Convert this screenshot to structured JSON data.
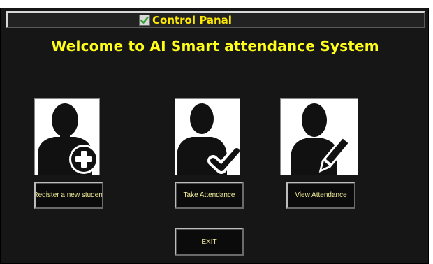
{
  "window": {
    "title": "Control Panal",
    "title_icon": "checkbox-icon"
  },
  "heading": "Welcome to AI Smart attendance System",
  "actions": [
    {
      "label": "Register a new student",
      "icon": "user-add-icon"
    },
    {
      "label": "Take Attendance",
      "icon": "user-check-icon"
    },
    {
      "label": "View Attendance",
      "icon": "user-edit-icon"
    }
  ],
  "exit_label": "EXIT",
  "colors": {
    "background": "#161616",
    "heading": "#ffff1a",
    "button_text": "#f2ec9a",
    "title_text": "#ffe800",
    "check_green": "#2e9e2e"
  }
}
